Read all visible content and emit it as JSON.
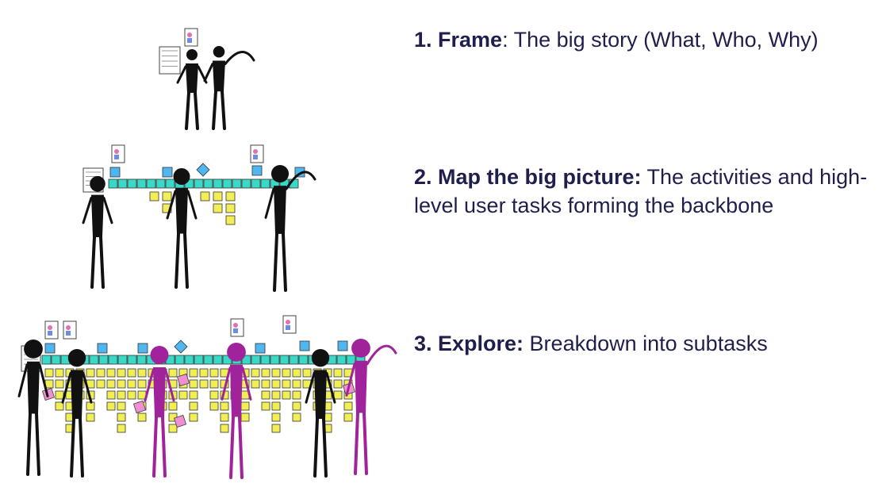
{
  "steps": [
    {
      "label": "1. Frame",
      "text": ": The big story (What, Who, Why)"
    },
    {
      "label": "2. Map the big picture:",
      "text": " The activities and high-level user tasks forming the backbone"
    },
    {
      "label": "3. Explore:",
      "text": " Breakdown into subtasks"
    }
  ],
  "colors": {
    "text": "#1f1f4d",
    "stick_figure": "#111111",
    "stick_figure_new": "#a1239b",
    "backbone_note": "#39d9c7",
    "activity_note": "#4fb6ef",
    "task_note": "#f2ef56",
    "pink_note": "#ef8fd0"
  }
}
